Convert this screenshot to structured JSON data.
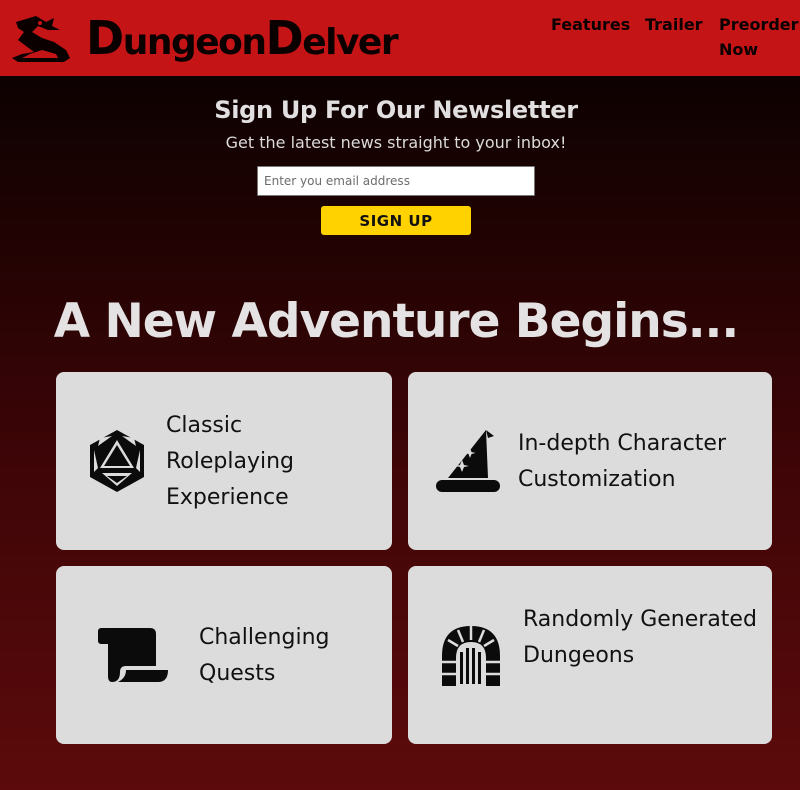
{
  "header": {
    "brand_part1_cap": "D",
    "brand_part1_rest": "ungeon",
    "brand_part2_cap": "D",
    "brand_part2_rest": "elver",
    "logo_icon": "dragon-icon",
    "nav": {
      "features": "Features",
      "trailer": "Trailer",
      "preorder": "Preorder Now"
    }
  },
  "newsletter": {
    "title": "Sign Up For Our Newsletter",
    "subtitle": "Get the latest news straight to your inbox!",
    "email_placeholder": "Enter you email address",
    "button": "SIGN UP"
  },
  "hero": {
    "title": "A New Adventure Begins..."
  },
  "features": [
    {
      "icon": "d20-dice-icon",
      "label": "Classic Roleplaying Experience"
    },
    {
      "icon": "wizard-hat-icon",
      "label": "In-depth Character Customization"
    },
    {
      "icon": "scroll-icon",
      "label": "Challenging Quests"
    },
    {
      "icon": "dungeon-gate-icon",
      "label": "Randomly Generated Dungeons"
    }
  ],
  "colors": {
    "header_bg": "#c41416",
    "accent_button": "#ffd200",
    "card_bg": "#dcdcdc",
    "text_light": "#e4e2e2"
  }
}
